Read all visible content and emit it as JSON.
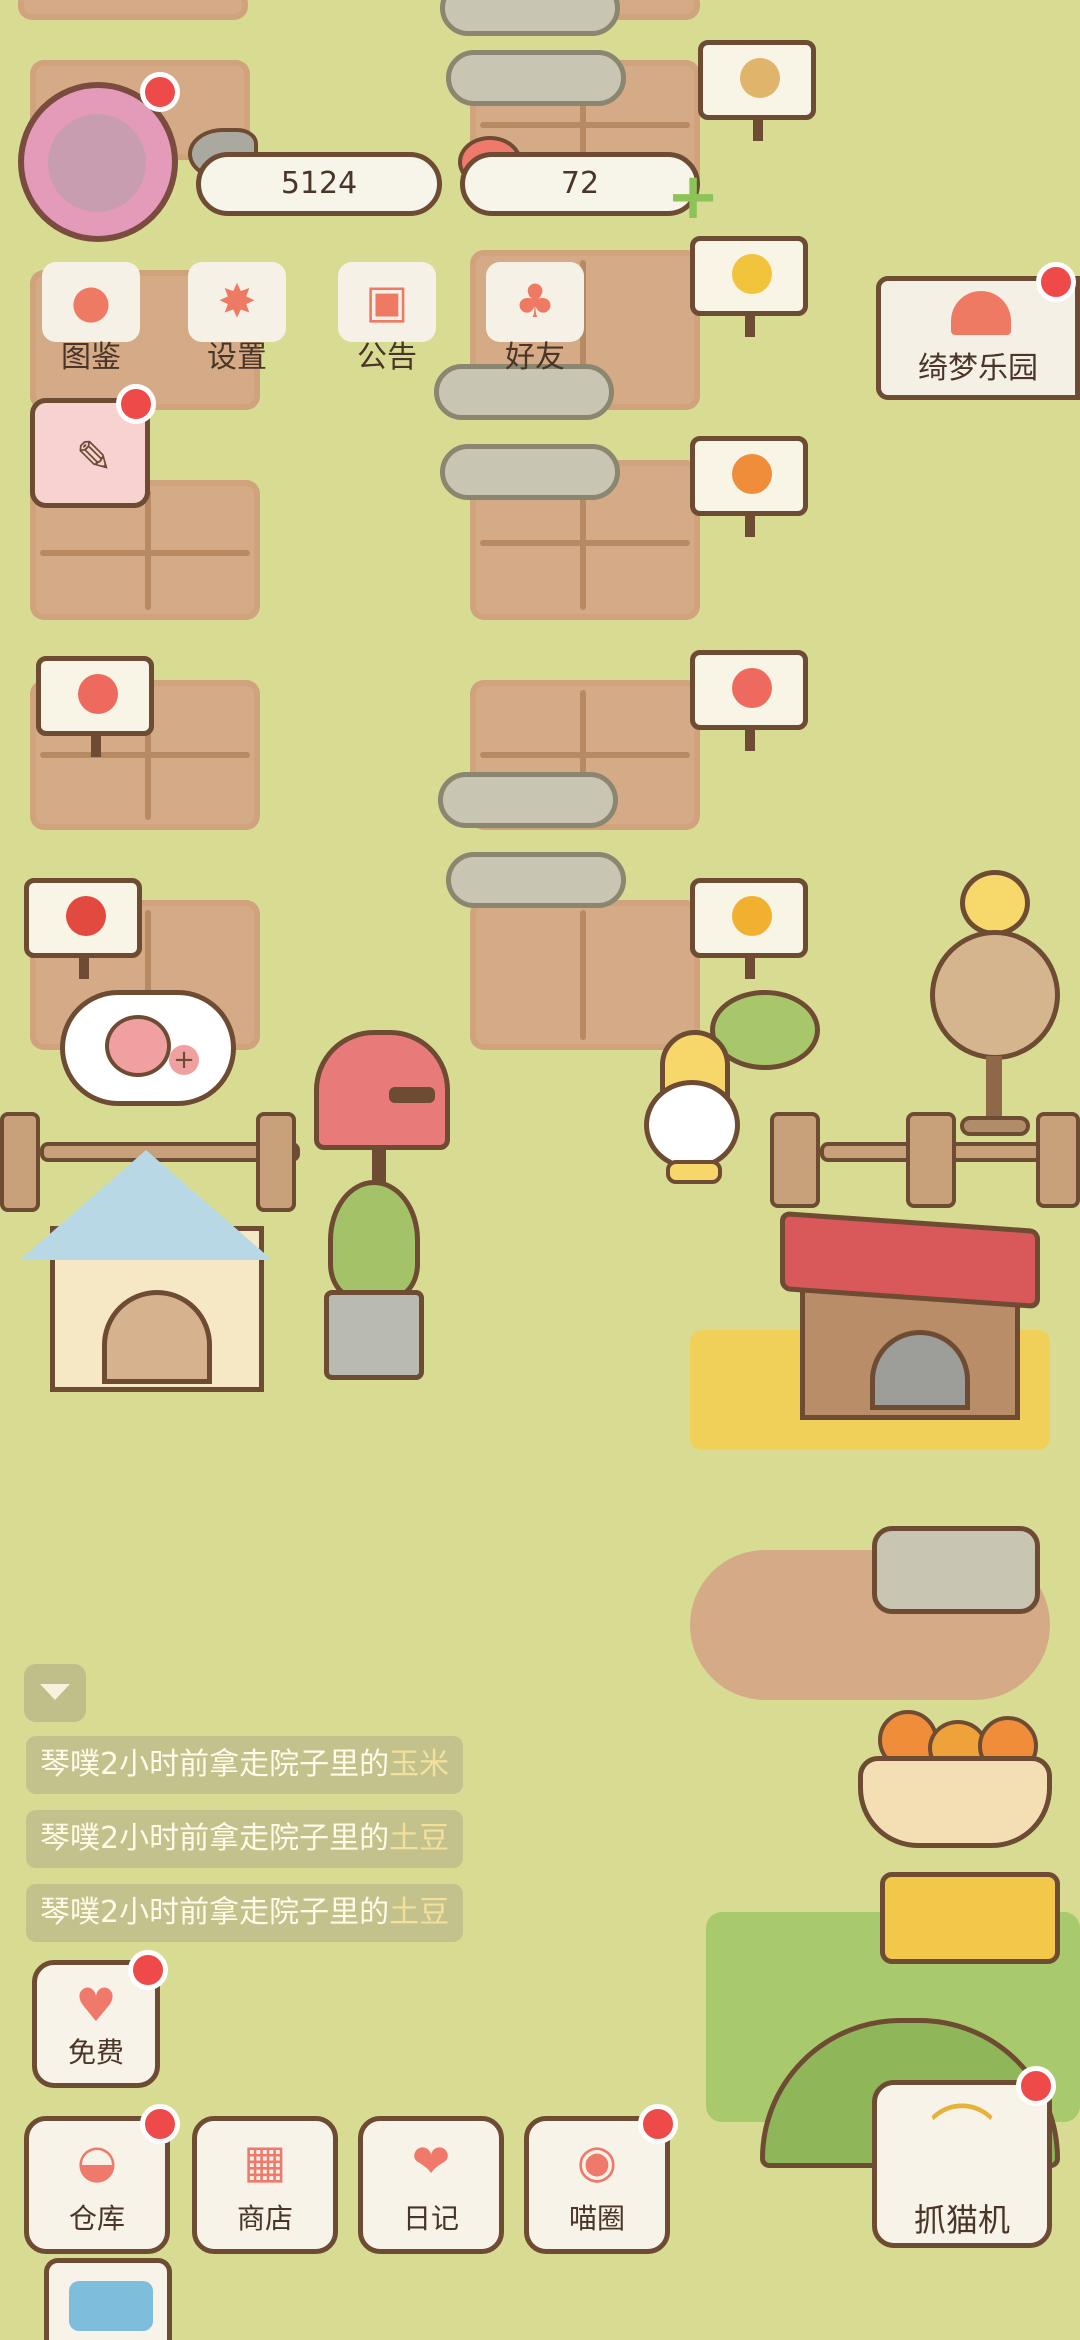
{
  "currency": {
    "fish": "5124",
    "hearts": "72"
  },
  "menu": [
    {
      "label": "图鉴",
      "icon": "cat-book-icon"
    },
    {
      "label": "设置",
      "icon": "gear-icon"
    },
    {
      "label": "公告",
      "icon": "gift-icon"
    },
    {
      "label": "好友",
      "icon": "friends-icon"
    }
  ],
  "event_banner": {
    "label": "绮梦乐园"
  },
  "logs": [
    {
      "prefix": "琴噗2小时前拿走院子里的",
      "item": "玉米"
    },
    {
      "prefix": "琴噗2小时前拿走院子里的",
      "item": "土豆"
    },
    {
      "prefix": "琴噗2小时前拿走院子里的",
      "item": "土豆"
    }
  ],
  "free_button": {
    "label": "免费"
  },
  "bottom_bar": [
    {
      "label": "仓库",
      "icon": "warehouse-icon"
    },
    {
      "label": "商店",
      "icon": "shop-icon"
    },
    {
      "label": "日记",
      "icon": "diary-icon"
    },
    {
      "label": "喵圈",
      "icon": "cat-planet-icon"
    }
  ],
  "claw_machine": {
    "label": "抓猫机"
  },
  "colors": {
    "grass": "#d8dc93",
    "soil": "#d4ab86",
    "outline": "#6e4b33",
    "badge": "#ef4a4a"
  }
}
